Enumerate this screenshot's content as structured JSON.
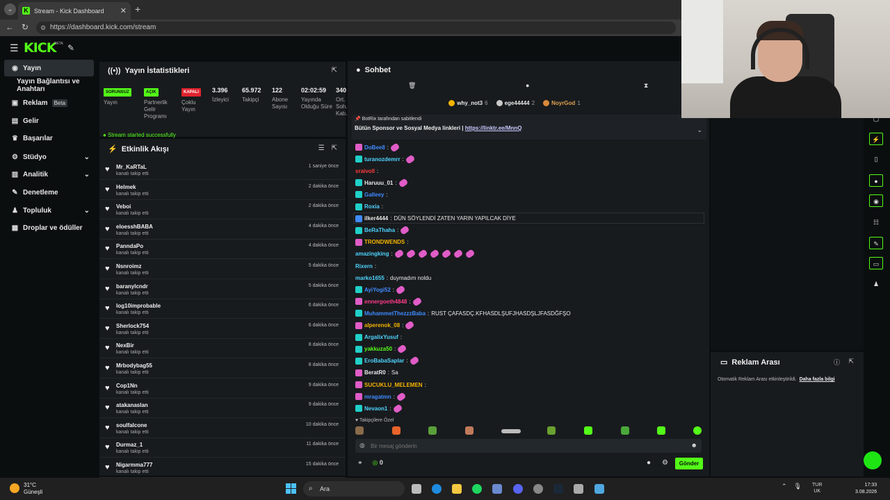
{
  "browser": {
    "tab_title": "Stream - Kick Dashboard",
    "url": "https://dashboard.kick.com/stream",
    "new_tab": "+",
    "close": "✕"
  },
  "header": {
    "logo": "KICK",
    "logo_badge": "BETA"
  },
  "sidebar": {
    "items": [
      {
        "label": "Yayın",
        "icon": "broadcast-icon"
      },
      {
        "label": "Yayın Bağlantısı ve Anahtarı",
        "icon": "key-icon"
      },
      {
        "label": "Reklam",
        "badge": "Beta",
        "icon": "ad-icon"
      },
      {
        "label": "Gelir",
        "icon": "revenue-icon"
      },
      {
        "label": "Başarılar",
        "icon": "trophy-icon"
      },
      {
        "label": "Stüdyo",
        "icon": "studio-icon"
      },
      {
        "label": "Analitik",
        "icon": "chart-icon"
      },
      {
        "label": "Denetleme",
        "icon": "wrench-icon"
      },
      {
        "label": "Topluluk",
        "icon": "community-icon"
      },
      {
        "label": "Droplar ve ödüller",
        "icon": "gift-icon"
      }
    ]
  },
  "stats": {
    "title": "Yayın İstatistikleri",
    "columns": [
      {
        "value": "SORUNSUZ",
        "label": "Yayın",
        "kind": "green"
      },
      {
        "value": "AÇIK",
        "label": "Partnerlik Gelir Programı",
        "kind": "green"
      },
      {
        "value": "KAPALI",
        "label": "Çoklu Yayın",
        "kind": "red"
      },
      {
        "value": "3.396",
        "label": "İzleyici",
        "kind": "num"
      },
      {
        "value": "65.972",
        "label": "Takipçi",
        "kind": "num"
      },
      {
        "value": "122",
        "label": "Abone Sayısı",
        "kind": "num"
      },
      {
        "value": "02:02:59",
        "label": "Yayında Olduğu Süre",
        "kind": "num"
      },
      {
        "value": "340",
        "label": "Ort. Soh. Katı.",
        "kind": "num"
      }
    ],
    "status_msg": "Stream started successfully"
  },
  "feed": {
    "title": "Etkinlik Akışı",
    "events": [
      {
        "name": "Mr_KaRTaL",
        "sub": "kanalı takip etti",
        "time": "1 saniye önce"
      },
      {
        "name": "Helmek",
        "sub": "kanalı takip etti",
        "time": "2 dakika önce"
      },
      {
        "name": "Veboi",
        "sub": "kanalı takip etti",
        "time": "2 dakika önce"
      },
      {
        "name": "eloesshBABA",
        "sub": "kanalı takip etti",
        "time": "4 dakika önce"
      },
      {
        "name": "PanndaPo",
        "sub": "kanalı takip etti",
        "time": "4 dakika önce"
      },
      {
        "name": "Nsnroimz",
        "sub": "kanalı takip etti",
        "time": "5 dakika önce"
      },
      {
        "name": "baranylcndr",
        "sub": "kanalı takip etti",
        "time": "5 dakika önce"
      },
      {
        "name": "log10improbable",
        "sub": "kanalı takip etti",
        "time": "6 dakika önce"
      },
      {
        "name": "Sherlock754",
        "sub": "kanalı takip etti",
        "time": "6 dakika önce"
      },
      {
        "name": "NexBir",
        "sub": "kanalı takip etti",
        "time": "8 dakika önce"
      },
      {
        "name": "Mrbodybag55",
        "sub": "kanalı takip etti",
        "time": "8 dakika önce"
      },
      {
        "name": "Cop1Nn",
        "sub": "kanalı takip etti",
        "time": "9 dakika önce"
      },
      {
        "name": "atakanaslan",
        "sub": "kanalı takip etti",
        "time": "9 dakika önce"
      },
      {
        "name": "soulfalcone",
        "sub": "kanalı takip etti",
        "time": "10 dakika önce"
      },
      {
        "name": "Durmaz_1",
        "sub": "kanalı takip etti",
        "time": "11 dakika önce"
      },
      {
        "name": "Nigarmma777",
        "sub": "kanalı takip etti",
        "time": "15 dakika önce"
      }
    ]
  },
  "chat": {
    "title": "Sohbet",
    "leaders": [
      {
        "name": "why_not3",
        "count": "6",
        "color": "#f5b400"
      },
      {
        "name": "ege44444",
        "count": "2",
        "color": "#c9c9c9"
      },
      {
        "name": "NoyrGod",
        "count": "1",
        "color": "#d98a3a"
      }
    ],
    "pinned_by": "BotRix tarafından sabitlendi",
    "pinned_text": "Bütün Sponsor ve Sosyal Medya linkleri |",
    "pinned_link": "https://linktr.ee/MnnQ",
    "messages": [
      {
        "user": "DoBee8",
        "color": "#3f8bff",
        "badge": "#e05cc7",
        "text": "",
        "emotes": 1
      },
      {
        "user": "turanozdemrr",
        "color": "#4fd4ff",
        "badge": "#20d0c8",
        "text": "",
        "emotes": 1
      },
      {
        "user": "sraivoll",
        "color": "#ff3b3b",
        "badge": "",
        "text": "",
        "emotes": 0
      },
      {
        "user": "Haruuu_01",
        "color": "#e8e8e8",
        "badge": "#20d0c8",
        "text": "",
        "emotes": 1
      },
      {
        "user": "Galleey",
        "color": "#3f8bff",
        "badge": "#20d0c8",
        "text": "",
        "emotes": 0
      },
      {
        "user": "Roxia",
        "color": "#4fd4ff",
        "badge": "#20d0c8",
        "text": "",
        "emotes": 0
      },
      {
        "user": "ilker4444",
        "color": "#e8e8e8",
        "badge": "#3f8bff",
        "text": "DÜN SÖYLENDİ ZATEN YARIN YAPILCAK DİYE",
        "emotes": 0
      },
      {
        "user": "BeRaThaha",
        "color": "#4fd4ff",
        "badge": "#20d0c8",
        "text": "",
        "emotes": 1
      },
      {
        "user": "TRONDWENDS",
        "color": "#f5b400",
        "badge": "#e05cc7",
        "text": "",
        "emotes": 0
      },
      {
        "user": "amazingking",
        "color": "#4fd4ff",
        "badge": "",
        "text": "",
        "emotes": 7
      },
      {
        "user": "Rixern",
        "color": "#4fd4ff",
        "badge": "",
        "text": "",
        "emotes": 0
      },
      {
        "user": "marko1655",
        "color": "#4fd4ff",
        "badge": "",
        "text": "duymadım noldu",
        "emotes": 0
      },
      {
        "user": "AyiYogi52",
        "color": "#3f8bff",
        "badge": "#20d0c8",
        "text": "",
        "emotes": 1
      },
      {
        "user": "ennergoeth4848",
        "color": "#ff3b8b",
        "badge": "#e05cc7",
        "text": "",
        "emotes": 1
      },
      {
        "user": "MuhammetThezzzBaba",
        "color": "#3f8bff",
        "badge": "#20d0c8",
        "text": "RUST ÇAFASDÇ.KFHASDLŞUFJHASDŞLJFASDĞFŞO",
        "emotes": 0
      },
      {
        "user": "alperenok_08",
        "color": "#f5b400",
        "badge": "#e05cc7",
        "text": "",
        "emotes": 1
      },
      {
        "user": "ArgalixYusuf",
        "color": "#4fd4ff",
        "badge": "#20d0c8",
        "text": "",
        "emotes": 0
      },
      {
        "user": "yakkuza50",
        "color": "#53fc18",
        "badge": "#20d0c8",
        "text": "",
        "emotes": 1
      },
      {
        "user": "EroBabaSaplar",
        "color": "#4fd4ff",
        "badge": "#20d0c8",
        "text": "",
        "emotes": 1
      },
      {
        "user": "BeratR0",
        "color": "#e8e8e8",
        "badge": "#e05cc7",
        "text": "Sa",
        "emotes": 0
      },
      {
        "user": "SUCUKLU_MELEMEN",
        "color": "#f5b400",
        "badge": "#e05cc7",
        "text": "",
        "emotes": 0
      },
      {
        "user": "mragatmn",
        "color": "#3f8bff",
        "badge": "#e05cc7",
        "text": "",
        "emotes": 1
      },
      {
        "user": "Nevaon1",
        "color": "#4fd4ff",
        "badge": "#20d0c8",
        "text": "",
        "emotes": 1
      }
    ],
    "follow_only": "Takipçilere Özel",
    "input_placeholder": "Bir mesaj gönderin",
    "points": "0",
    "send": "Gönder"
  },
  "adbreak": {
    "title": "Reklam Arası",
    "text": "Otomatik Reklam Arası etkinleştirildi.",
    "link": "Daha fazla bilgi"
  },
  "taskbar": {
    "temp": "31°C",
    "weather": "Güneşli",
    "search": "Ara",
    "lang1": "TUR",
    "lang2": "UK",
    "time": "17:33",
    "date": "3.08.2026"
  },
  "colors": {
    "accent": "#53fc18",
    "panel": "#181b1e",
    "bg": "#0b0e0f"
  }
}
